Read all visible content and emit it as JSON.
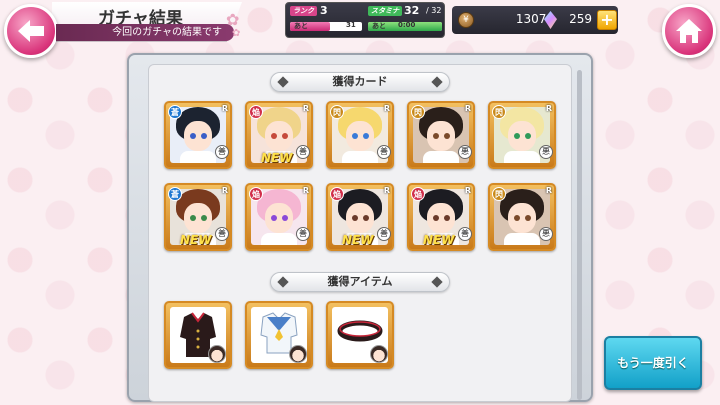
{
  "header": {
    "title": "ガチャ結果",
    "subtitle": "今回のガチャの結果です"
  },
  "stats": {
    "rank_label": "ランク",
    "rank_value": "3",
    "rank_next_prefix": "あと",
    "rank_next_value": "31",
    "rank_progress": 0.55,
    "stamina_label": "スタミナ",
    "stamina_value": "32",
    "stamina_max": "/ 32",
    "stamina_next_prefix": "あと",
    "stamina_next_value": "0:00",
    "stamina_progress": 1.0
  },
  "currency": {
    "coins": "13070",
    "gems": "259",
    "plus_label": "+"
  },
  "sections": {
    "cards_title": "獲得カード",
    "items_title": "獲得アイテム"
  },
  "cards": [
    {
      "type": "蒼",
      "type_color": "#1f78d1",
      "rarity": "R",
      "element": "善",
      "new": false,
      "hair": "#1c2330",
      "eye": "#3a5ec8",
      "bg": "#e9eef8"
    },
    {
      "type": "焔",
      "type_color": "#d12f4a",
      "rarity": "R",
      "element": "善",
      "new": true,
      "hair": "#f0d48a",
      "eye": "#c64a3a",
      "bg": "#f6e3da"
    },
    {
      "type": "閃",
      "type_color": "#c98a1a",
      "rarity": "R",
      "element": "善",
      "new": false,
      "hair": "#f6d86e",
      "eye": "#3a7ad8",
      "bg": "#f2eadf"
    },
    {
      "type": "閃",
      "type_color": "#c98a1a",
      "rarity": "R",
      "element": "悪",
      "new": false,
      "hair": "#2a1f1a",
      "eye": "#7a4a2a",
      "bg": "#d9c4b2"
    },
    {
      "type": "閃",
      "type_color": "#c98a1a",
      "rarity": "R",
      "element": "悪",
      "new": false,
      "hair": "#f3e6a3",
      "eye": "#2f9a5a",
      "bg": "#e6e8d0"
    },
    {
      "type": "蒼",
      "type_color": "#1f78d1",
      "rarity": "R",
      "element": "善",
      "new": true,
      "hair": "#7a3a1e",
      "eye": "#3a8a4a",
      "bg": "#e8e2da"
    },
    {
      "type": "焔",
      "type_color": "#d12f4a",
      "rarity": "R",
      "element": "善",
      "new": false,
      "hair": "#f5b6d2",
      "eye": "#8a4ad8",
      "bg": "#f6e6ee"
    },
    {
      "type": "焔",
      "type_color": "#d12f4a",
      "rarity": "R",
      "element": "善",
      "new": true,
      "hair": "#1c1c22",
      "eye": "#6a3a2a",
      "bg": "#eee6df"
    },
    {
      "type": "焔",
      "type_color": "#d12f4a",
      "rarity": "R",
      "element": "善",
      "new": true,
      "hair": "#1c1c22",
      "eye": "#6a3a2a",
      "bg": "#eee6df"
    },
    {
      "type": "閃",
      "type_color": "#c98a1a",
      "rarity": "R",
      "element": "悪",
      "new": false,
      "hair": "#2a1f1a",
      "eye": "#7a4a2a",
      "bg": "#d9c4b2"
    }
  ],
  "new_label": "NEW",
  "items": [
    {
      "name": "costume-jacket"
    },
    {
      "name": "costume-sailor"
    },
    {
      "name": "accessory-belt"
    }
  ],
  "actions": {
    "again_label": "もう一度引く"
  },
  "colors": {
    "accent_pink": "#d9337a",
    "card_gold": "#d58a24",
    "again_button": "#12a0c8"
  }
}
